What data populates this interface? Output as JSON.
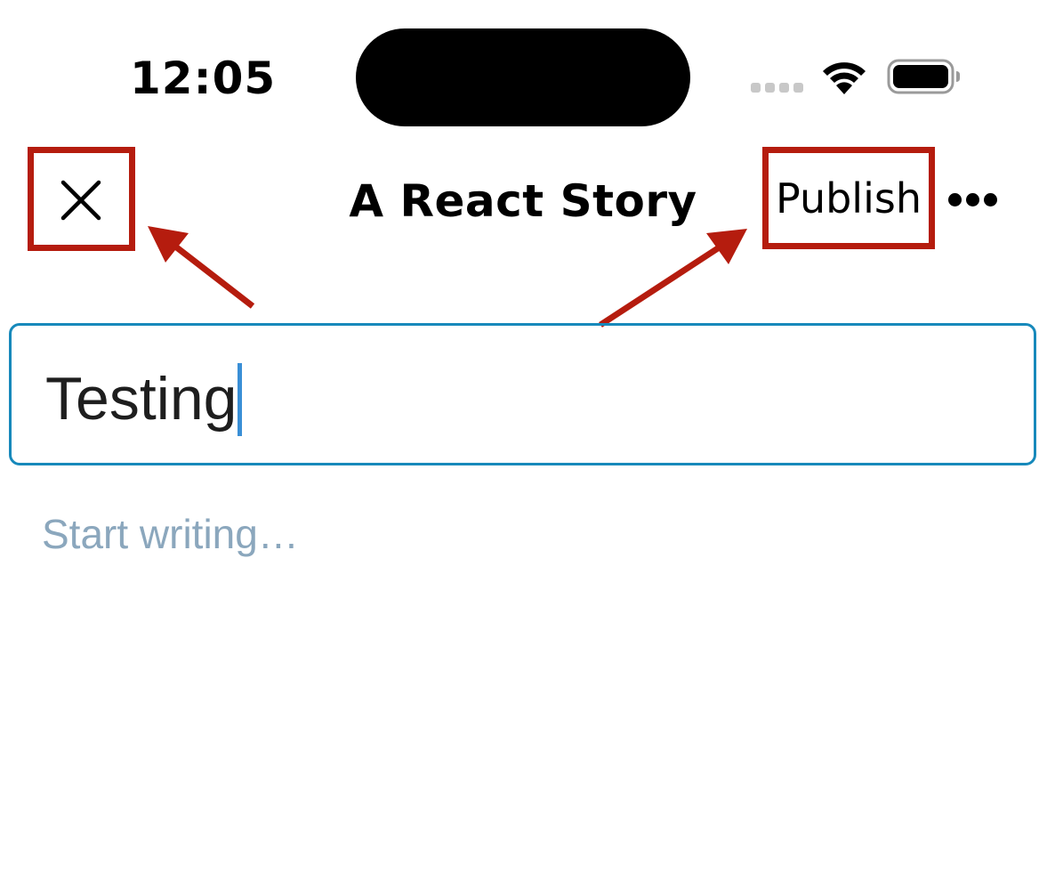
{
  "status_bar": {
    "time": "12:05",
    "cell_icon": "cellular-signal-icon",
    "wifi_icon": "wifi-icon",
    "battery_icon": "battery-icon"
  },
  "nav": {
    "close_icon": "close-icon",
    "title": "A React Story",
    "publish_label": "Publish",
    "more_icon": "more-horizontal-icon"
  },
  "editor": {
    "title_value": "Testing",
    "body_placeholder": "Start writing…"
  },
  "colors": {
    "annotation_red": "#b51c0e",
    "input_border": "#1789bb",
    "caret": "#3a8fd6",
    "placeholder": "#8ba7bd"
  }
}
